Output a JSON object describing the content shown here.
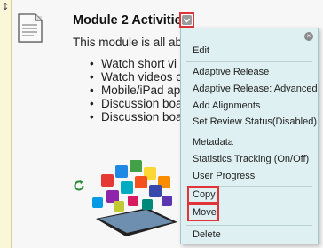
{
  "module": {
    "title": "Module 2 Activities",
    "intro": "This module is all ab",
    "bullets": [
      "Watch short vi",
      "Watch videos c",
      "Mobile/iPad ap",
      "Discussion boa",
      "Discussion boa"
    ]
  },
  "icons": {
    "drag_handle": "↕",
    "document": "document-icon",
    "refresh": "refresh-icon",
    "chevron": "chevron-down-icon",
    "close": "close-icon"
  },
  "context_menu": {
    "close_glyph": "×",
    "items": [
      "Edit",
      "Adaptive Release",
      "Adaptive Release: Advanced",
      "Add Alignments",
      "Set Review Status(Disabled)",
      "Metadata",
      "Statistics Tracking (On/Off)",
      "User Progress",
      "Copy",
      "Move",
      "Delete"
    ]
  },
  "colors": {
    "highlight": "#e0333a",
    "menu_bg": "#dff0f3",
    "stripe": "#faf6d8"
  }
}
